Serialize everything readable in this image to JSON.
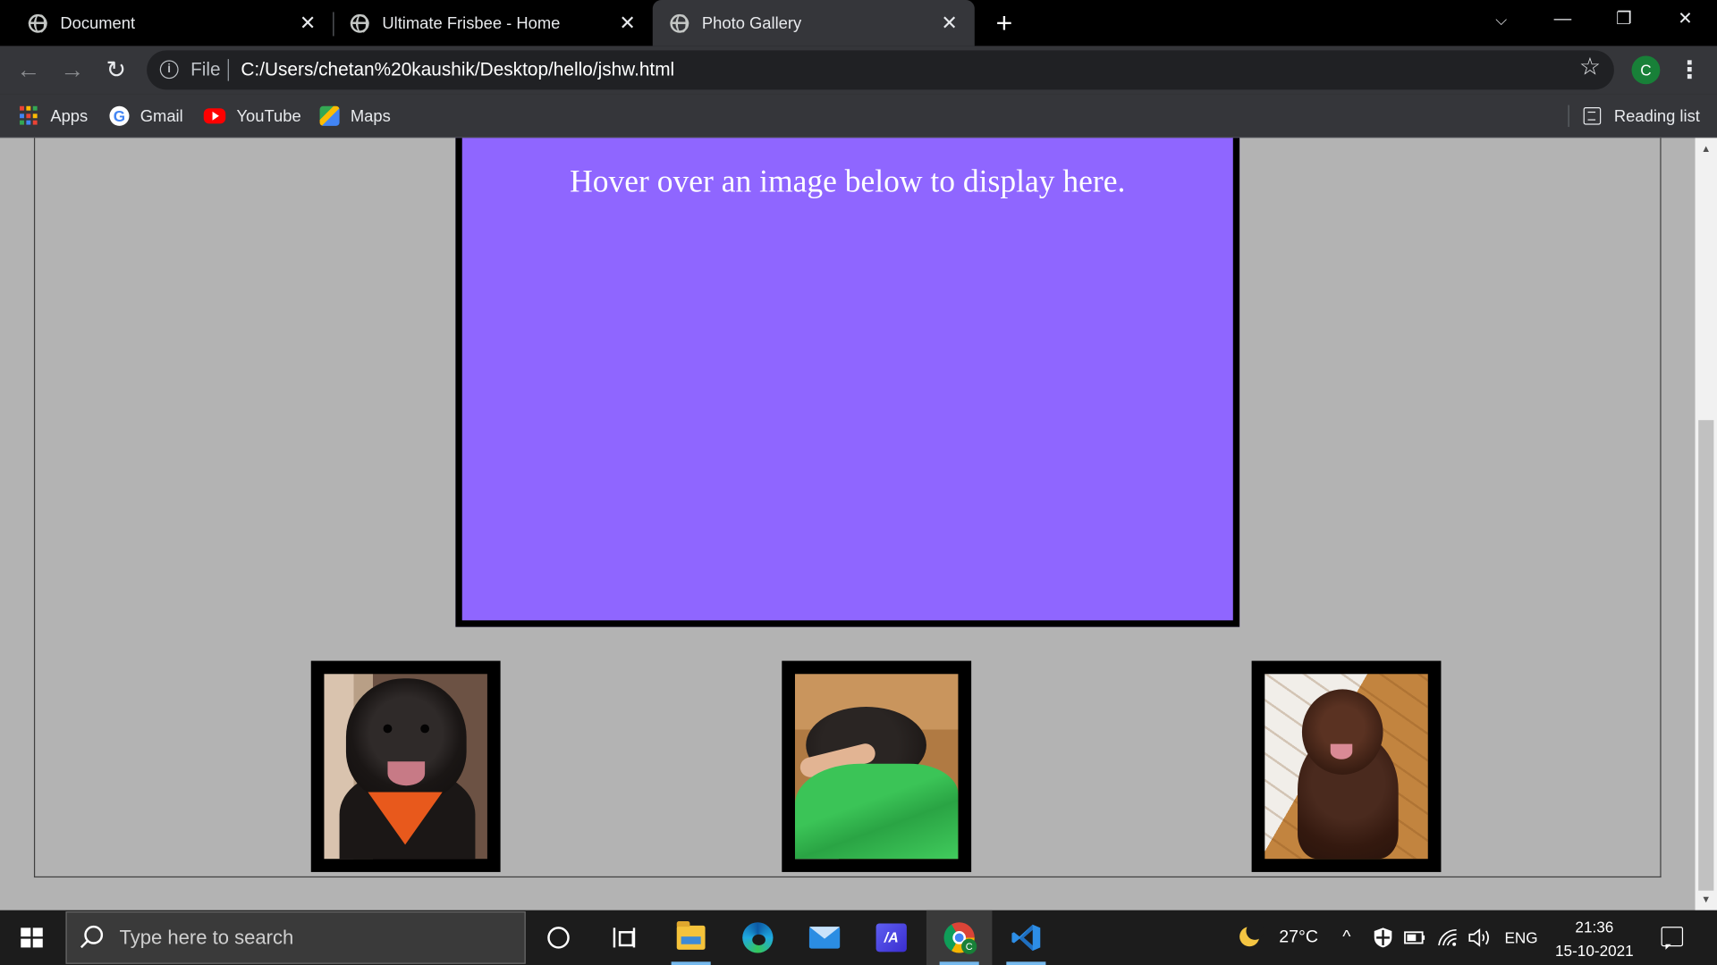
{
  "browser": {
    "tabs": [
      {
        "title": "Document",
        "close": "✕"
      },
      {
        "title": "Ultimate Frisbee - Home",
        "close": "✕"
      },
      {
        "title": "Photo Gallery",
        "close": "✕",
        "active": true
      }
    ],
    "new_tab": "+",
    "window_controls": {
      "tabsearch": "⌵",
      "minimize": "—",
      "restore": "❐",
      "close": "✕"
    },
    "nav": {
      "back": "←",
      "forward": "→",
      "reload": "↻"
    },
    "omnibox": {
      "info": "i",
      "scheme_label": "File",
      "url": "C:/Users/chetan%20kaushik/Desktop/hello/jshw.html"
    },
    "star": "☆",
    "profile_initial": "C",
    "menu": "⋮",
    "bookmarks": [
      {
        "label": "Apps",
        "icon": "apps-grid-icon"
      },
      {
        "label": "Gmail",
        "icon": "google-icon"
      },
      {
        "label": "YouTube",
        "icon": "youtube-icon"
      },
      {
        "label": "Maps",
        "icon": "maps-icon"
      }
    ],
    "reading_list": "Reading list"
  },
  "page": {
    "display_text": "Hover over an image below to display here.",
    "display_bg": "#8f66ff",
    "background": "#b3b3b3",
    "thumbnails": [
      {
        "name": "dog-with-orange-bandana"
      },
      {
        "name": "boy-hugging-dog"
      },
      {
        "name": "brown-dog-sitting"
      }
    ]
  },
  "scrollbar": {
    "up": "▲",
    "down": "▼"
  },
  "taskbar": {
    "search_placeholder": "Type here to search",
    "temperature": "27°C",
    "tray_chevron": "^",
    "language": "ENG",
    "time": "21:36",
    "date": "15-10-2021",
    "chrome_badge": "C",
    "vs_label": "/A"
  }
}
